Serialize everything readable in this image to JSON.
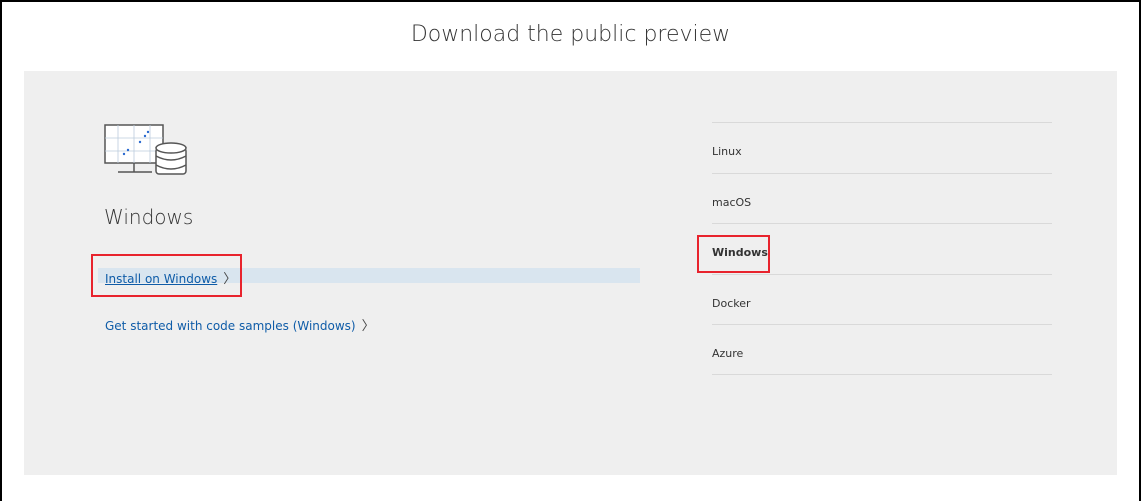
{
  "header": {
    "title": "Download the public preview"
  },
  "selected_os": {
    "icon": "monitor-database-icon",
    "heading": "Windows",
    "install_link": "Install on Windows",
    "samples_link": "Get started with code samples (Windows)",
    "chevron": "〉"
  },
  "os_menu": {
    "items": [
      {
        "label": "Linux"
      },
      {
        "label": "macOS"
      },
      {
        "label": "Windows"
      },
      {
        "label": "Docker"
      },
      {
        "label": "Azure"
      }
    ],
    "active": "Windows"
  },
  "colors": {
    "panel_bg": "#efefef",
    "link": "#0f5ca8",
    "highlight_box": "#e8232d"
  }
}
